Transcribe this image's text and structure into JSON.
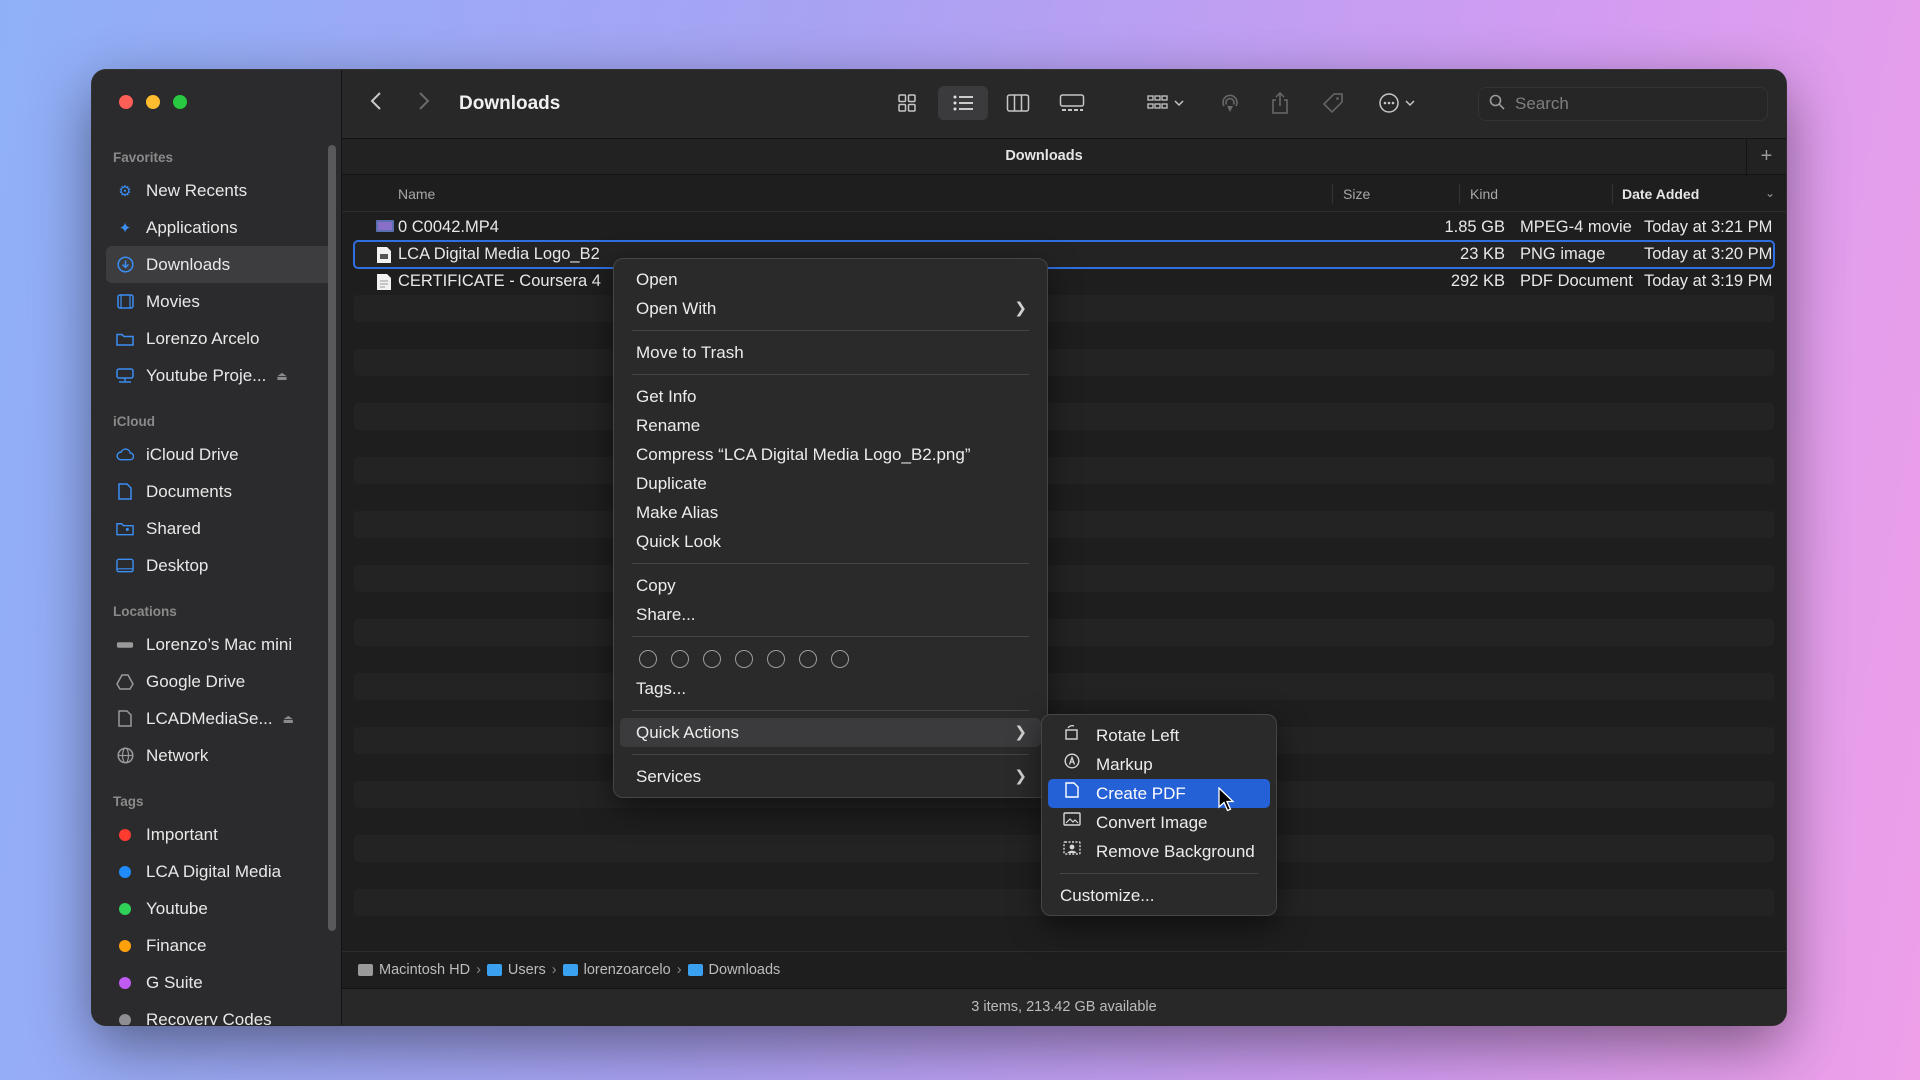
{
  "window": {
    "title": "Downloads",
    "tab_title": "Downloads"
  },
  "sidebar": {
    "favorites_label": "Favorites",
    "favorites": [
      {
        "label": "New Recents",
        "icon": "clock-gear-icon"
      },
      {
        "label": "Applications",
        "icon": "applications-icon"
      },
      {
        "label": "Downloads",
        "icon": "download-icon"
      },
      {
        "label": "Movies",
        "icon": "film-icon"
      },
      {
        "label": "Lorenzo Arcelo",
        "icon": "folder-icon"
      },
      {
        "label": "Youtube Proje...",
        "icon": "network-drive-icon"
      }
    ],
    "icloud_label": "iCloud",
    "icloud": [
      {
        "label": "iCloud Drive",
        "icon": "cloud-icon"
      },
      {
        "label": "Documents",
        "icon": "document-icon"
      },
      {
        "label": "Shared",
        "icon": "shared-folder-icon"
      },
      {
        "label": "Desktop",
        "icon": "desktop-icon"
      }
    ],
    "locations_label": "Locations",
    "locations": [
      {
        "label": "Lorenzo’s Mac mini",
        "icon": "mac-mini-icon"
      },
      {
        "label": "Google Drive",
        "icon": "drive-icon"
      },
      {
        "label": "LCADMediaSe...",
        "icon": "document-icon"
      },
      {
        "label": "Network",
        "icon": "globe-icon"
      }
    ],
    "tags_label": "Tags",
    "tags": [
      {
        "label": "Important",
        "color": "#ff3b30"
      },
      {
        "label": "LCA Digital Media",
        "color": "#1f8bff"
      },
      {
        "label": "Youtube",
        "color": "#30d158"
      },
      {
        "label": "Finance",
        "color": "#ff9f0a"
      },
      {
        "label": "G Suite",
        "color": "#bf5af2"
      },
      {
        "label": "Recovery Codes",
        "color": "#8e8e93"
      }
    ]
  },
  "toolbar": {
    "search_placeholder": "Search"
  },
  "columns": {
    "name": "Name",
    "size": "Size",
    "kind": "Kind",
    "date": "Date Added"
  },
  "files": [
    {
      "name": "0 C0042.MP4",
      "size": "1.85 GB",
      "kind": "MPEG-4 movie",
      "date": "Today at 3:21 PM"
    },
    {
      "name": "LCA Digital Media Logo_B2",
      "size": "23 KB",
      "kind": "PNG image",
      "date": "Today at 3:20 PM"
    },
    {
      "name": "CERTIFICATE - Coursera 4",
      "size": "292 KB",
      "kind": "PDF Document",
      "date": "Today at 3:19 PM"
    }
  ],
  "context_menu": {
    "open": "Open",
    "open_with": "Open With",
    "move_to_trash": "Move to Trash",
    "get_info": "Get Info",
    "rename": "Rename",
    "compress": "Compress “LCA Digital Media Logo_B2.png”",
    "duplicate": "Duplicate",
    "make_alias": "Make Alias",
    "quick_look": "Quick Look",
    "copy": "Copy",
    "share": "Share...",
    "tags": "Tags...",
    "quick_actions": "Quick Actions",
    "services": "Services"
  },
  "quick_actions_menu": {
    "rotate_left": "Rotate Left",
    "markup": "Markup",
    "create_pdf": "Create PDF",
    "convert_image": "Convert Image",
    "remove_background": "Remove Background",
    "customize": "Customize..."
  },
  "pathbar": [
    "Macintosh HD",
    "Users",
    "lorenzoarcelo",
    "Downloads"
  ],
  "status": "3 items, 213.42 GB available"
}
